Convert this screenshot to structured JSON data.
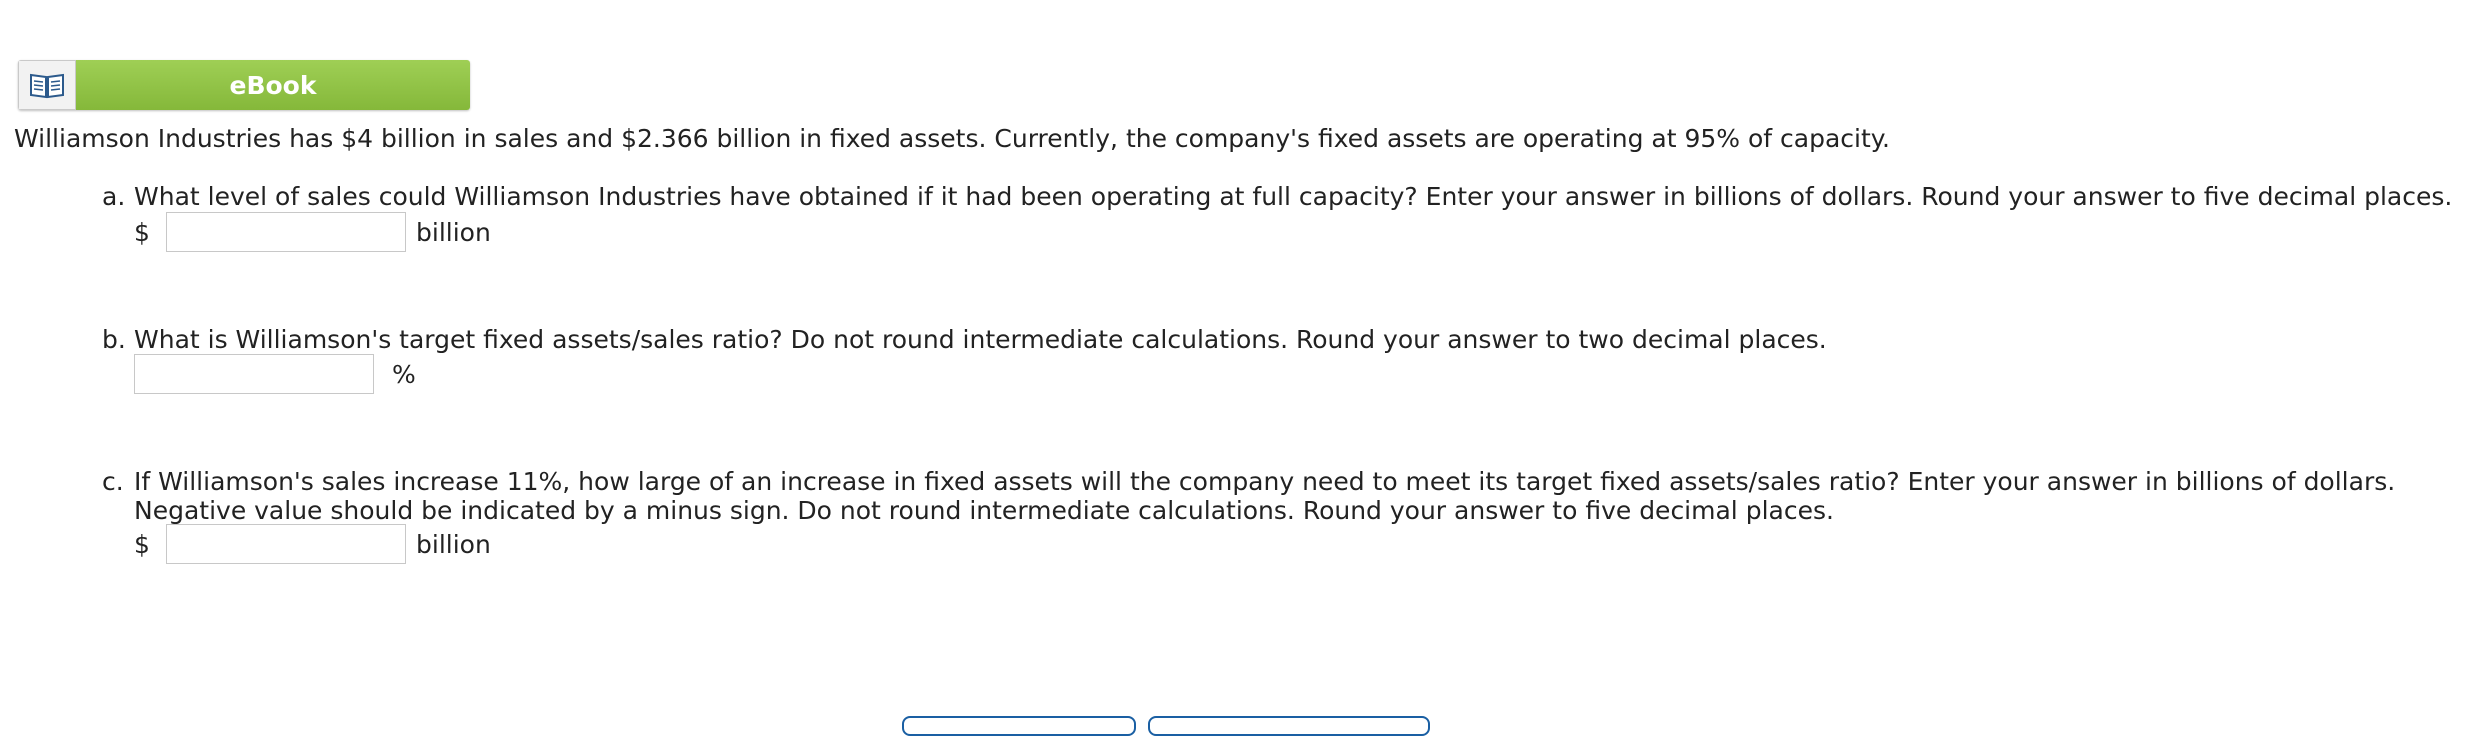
{
  "ebook": {
    "label": "eBook",
    "icon": "open-book-icon",
    "color": "#8fc447"
  },
  "intro": "Williamson Industries has $4 billion in sales and $2.366 billion in fixed assets. Currently, the company's fixed assets are operating at 95% of capacity.",
  "questions": [
    {
      "letter": "a.",
      "text": "What level of sales could Williamson Industries have obtained if it had been operating at full capacity? Enter your answer in billions of dollars. Round your answer to five decimal places.",
      "prefix": "$",
      "suffix": "billion",
      "value": ""
    },
    {
      "letter": "b.",
      "text": "What is Williamson's target fixed assets/sales ratio? Do not round intermediate calculations. Round your answer to two decimal places.",
      "prefix": "",
      "suffix": "%",
      "value": ""
    },
    {
      "letter": "c.",
      "text": "If Williamson's sales increase 11%, how large of an increase in fixed assets will the company need to meet its target fixed assets/sales ratio? Enter your answer in billions of dollars. Negative value should be indicated by a minus sign. Do not round intermediate calculations. Round your answer to five decimal places.",
      "prefix": "$",
      "suffix": "billion",
      "value": ""
    }
  ]
}
